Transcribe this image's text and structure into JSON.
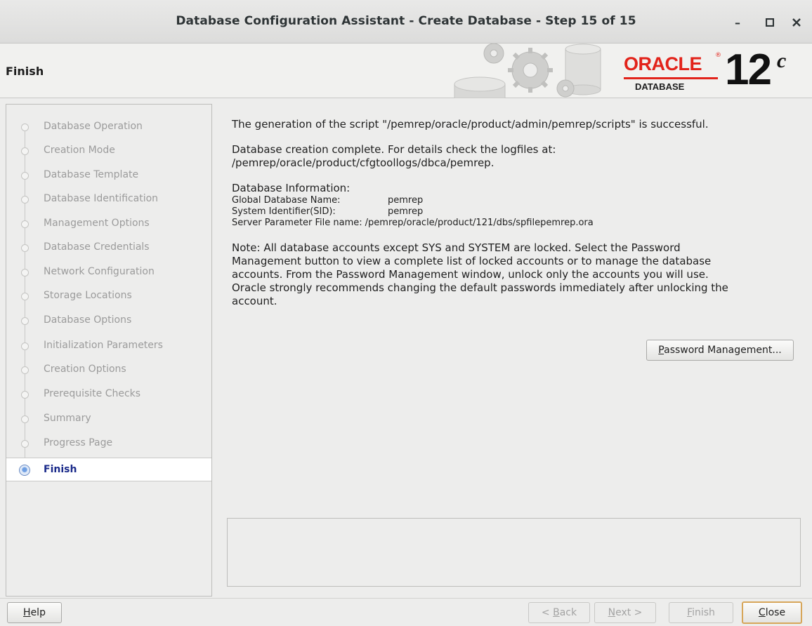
{
  "window": {
    "title": "Database Configuration Assistant - Create Database - Step 15 of 15",
    "minimize_glyph": "–",
    "maximize_glyph": "□",
    "close_glyph": "✕"
  },
  "header": {
    "page_title": "Finish",
    "logo": {
      "oracle": "ORACLE",
      "reg": "®",
      "database": "DATABASE",
      "version": "12",
      "suffix": "c"
    }
  },
  "nav": {
    "items": [
      {
        "label": "Database Operation",
        "state": "done"
      },
      {
        "label": "Creation Mode",
        "state": "done"
      },
      {
        "label": "Database Template",
        "state": "done"
      },
      {
        "label": "Database Identification",
        "state": "done"
      },
      {
        "label": "Management Options",
        "state": "done"
      },
      {
        "label": "Database Credentials",
        "state": "done"
      },
      {
        "label": "Network Configuration",
        "state": "done"
      },
      {
        "label": "Storage Locations",
        "state": "done"
      },
      {
        "label": "Database Options",
        "state": "done"
      },
      {
        "label": "Initialization Parameters",
        "state": "done"
      },
      {
        "label": "Creation Options",
        "state": "done"
      },
      {
        "label": "Prerequisite Checks",
        "state": "done"
      },
      {
        "label": "Summary",
        "state": "done"
      },
      {
        "label": "Progress Page",
        "state": "done"
      },
      {
        "label": "Finish",
        "state": "active"
      }
    ]
  },
  "content": {
    "script_message": "The generation of the script \"/pemrep/oracle/product/admin/pemrep/scripts\" is successful.",
    "creation_line1": "Database creation complete. For details check the logfiles at:",
    "creation_line2": " /pemrep/oracle/product/cfgtoollogs/dbca/pemrep.",
    "info_heading": "Database Information:",
    "info": {
      "gdn_label": "Global Database Name:",
      "gdn_value": "pemrep",
      "sid_label": "System Identifier(SID):",
      "sid_value": "pemrep",
      "spfile_label": "Server Parameter File name:",
      "spfile_value": "/pemrep/oracle/product/121/dbs/spfilepemrep.ora"
    },
    "note_lines": [
      "Note: All database accounts except SYS and SYSTEM are locked. Select the Password",
      "Management button to view a complete list of locked accounts or to manage the database",
      "accounts. From the Password Management window, unlock only the accounts you will use.",
      "Oracle strongly recommends changing the default passwords immediately after unlocking the",
      "account."
    ],
    "password_button": {
      "mnemonic": "P",
      "rest": "assword Management..."
    }
  },
  "footer": {
    "help": {
      "mnemonic": "H",
      "rest": "elp"
    },
    "back": {
      "pre": "< ",
      "mnemonic": "B",
      "rest": "ack"
    },
    "next": {
      "mnemonic": "N",
      "rest": "ext >"
    },
    "finish": {
      "mnemonic": "F",
      "rest": "inish"
    },
    "close": {
      "mnemonic": "C",
      "rest": "lose"
    }
  },
  "colors": {
    "oracle_red": "#e2231a",
    "active_nav_text": "#1a2a8a",
    "default_button_border": "#d7a65a"
  }
}
